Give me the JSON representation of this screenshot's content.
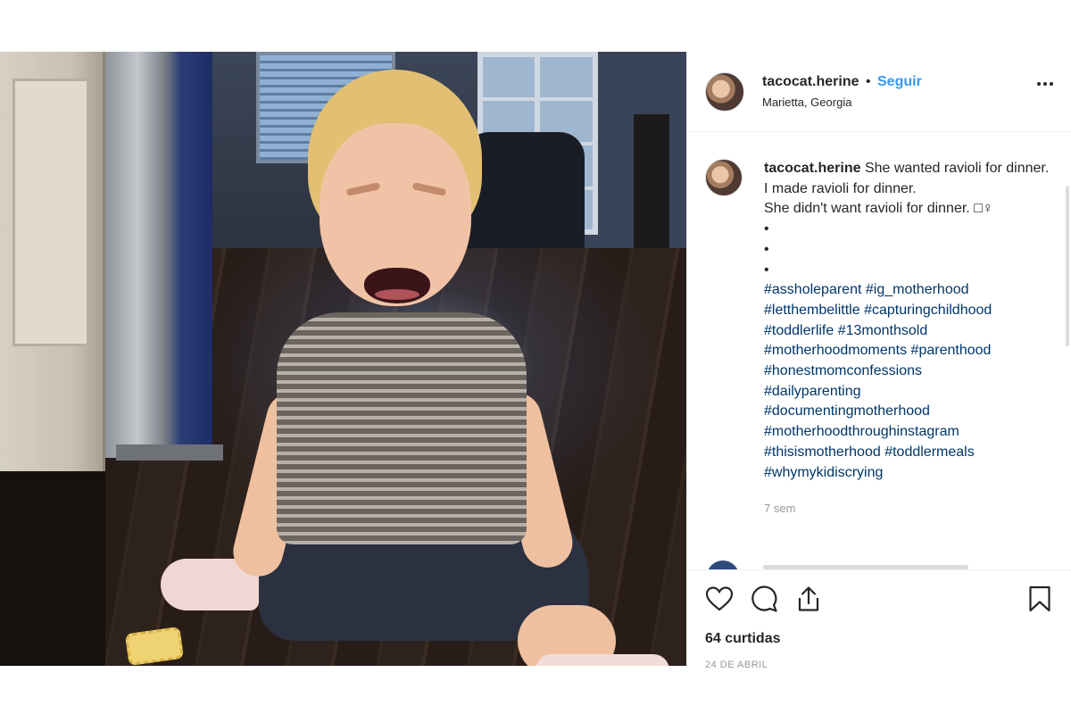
{
  "header": {
    "username": "tacocat.herine",
    "separator": "•",
    "follow_label": "Seguir",
    "location": "Marietta, Georgia"
  },
  "caption": {
    "username": "tacocat.herine",
    "line1": "She wanted ravioli for dinner.",
    "line2": "I made ravioli for dinner.",
    "line3": "She didn't want ravioli for dinner. □♀",
    "bullets": [
      "•",
      "•",
      "•"
    ],
    "hashtags": [
      "#assholeparent",
      "#ig_motherhood",
      "#letthembelittle",
      "#capturingchildhood",
      "#toddlerlife",
      "#13monthsold",
      "#motherhoodmoments",
      "#parenthood",
      "#honestmomconfessions",
      "#dailyparenting",
      "#documentingmotherhood",
      "#motherhoodthroughinstagram",
      "#thisismotherhood",
      "#toddlermeals",
      "#whymykidiscrying"
    ],
    "age": "7 sem"
  },
  "actions": {
    "icons": [
      "heart-icon",
      "comment-icon",
      "share-icon",
      "bookmark-icon"
    ],
    "likes": "64 curtidas",
    "date": "24 DE ABRIL"
  },
  "colors": {
    "link_blue": "#3897f0",
    "hashtag_blue": "#003569",
    "text": "#262626",
    "muted": "#999999"
  }
}
